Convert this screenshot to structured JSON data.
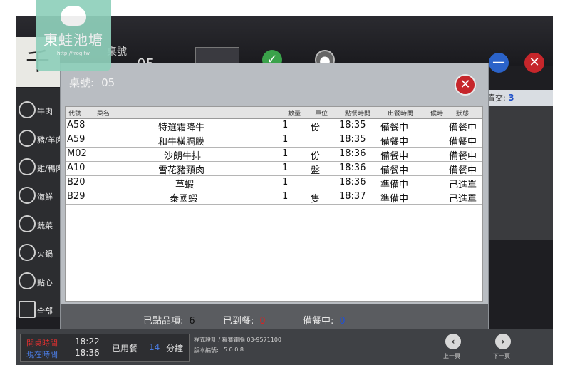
{
  "watermark": {
    "title": "東蛙池塘",
    "url": "http://frog.tw"
  },
  "background": {
    "brand_glyph": "千",
    "table_label": "桌號",
    "table_number": "05",
    "orders_label": "賣交:",
    "orders_count": "3"
  },
  "sidebar": {
    "items": [
      {
        "label": "牛肉",
        "icon": "cow-icon"
      },
      {
        "label": "豬/羊肉",
        "icon": "pig-icon"
      },
      {
        "label": "雞/鴨肉",
        "icon": "chicken-icon"
      },
      {
        "label": "海鮮",
        "icon": "fish-icon"
      },
      {
        "label": "蔬菜",
        "icon": "vegetable-icon"
      },
      {
        "label": "火鍋",
        "icon": "hotpot-icon"
      },
      {
        "label": "點心",
        "icon": "dessert-icon"
      },
      {
        "label": "全部",
        "icon": "list-icon"
      }
    ]
  },
  "dialog": {
    "table_label": "桌號:",
    "table_number": "05",
    "columns": [
      "代號",
      "菜名",
      "數量",
      "單位",
      "點餐時間",
      "出餐時間",
      "候時",
      "狀態"
    ],
    "rows": [
      {
        "code": "A58",
        "name": "特選霜降牛",
        "qty": "1",
        "unit": "份",
        "order_time": "18:35",
        "serve_time": "備餐中",
        "wait": "",
        "status": "備餐中"
      },
      {
        "code": "A59",
        "name": "和牛橫膈膜",
        "qty": "1",
        "unit": "",
        "order_time": "18:35",
        "serve_time": "備餐中",
        "wait": "",
        "status": "備餐中"
      },
      {
        "code": "M02",
        "name": "沙朗牛排",
        "qty": "1",
        "unit": "份",
        "order_time": "18:36",
        "serve_time": "備餐中",
        "wait": "",
        "status": "備餐中"
      },
      {
        "code": "A10",
        "name": "雪花豬頸肉",
        "qty": "1",
        "unit": "盤",
        "order_time": "18:36",
        "serve_time": "備餐中",
        "wait": "",
        "status": "備餐中"
      },
      {
        "code": "B20",
        "name": "草蝦",
        "qty": "1",
        "unit": "",
        "order_time": "18:36",
        "serve_time": "準備中",
        "wait": "",
        "status": "己進單"
      },
      {
        "code": "B29",
        "name": "泰國蝦",
        "qty": "1",
        "unit": "隻",
        "order_time": "18:37",
        "serve_time": "準備中",
        "wait": "",
        "status": "己進單"
      }
    ],
    "stats": {
      "ordered_label": "已點品項:",
      "ordered_value": "6",
      "arrived_label": "已到餐:",
      "arrived_value": "0",
      "preparing_label": "備餐中:",
      "preparing_value": "0"
    },
    "colors": {
      "arrived": "#e02020",
      "preparing": "#1f50d8",
      "close": "#c6262b"
    }
  },
  "footer": {
    "open_label": "開桌時間",
    "open_time": "18:22",
    "now_label": "現在時間",
    "now_time": "18:36",
    "used_label": "已用餐",
    "used_minutes": "14",
    "minutes_unit": "分鐘",
    "design_credit": "程式設計 / 糧響電腦 03-9571100",
    "version_label": "版本編號:",
    "version": "5.0.0.8",
    "prev_label": "上一頁",
    "next_label": "下一頁"
  }
}
